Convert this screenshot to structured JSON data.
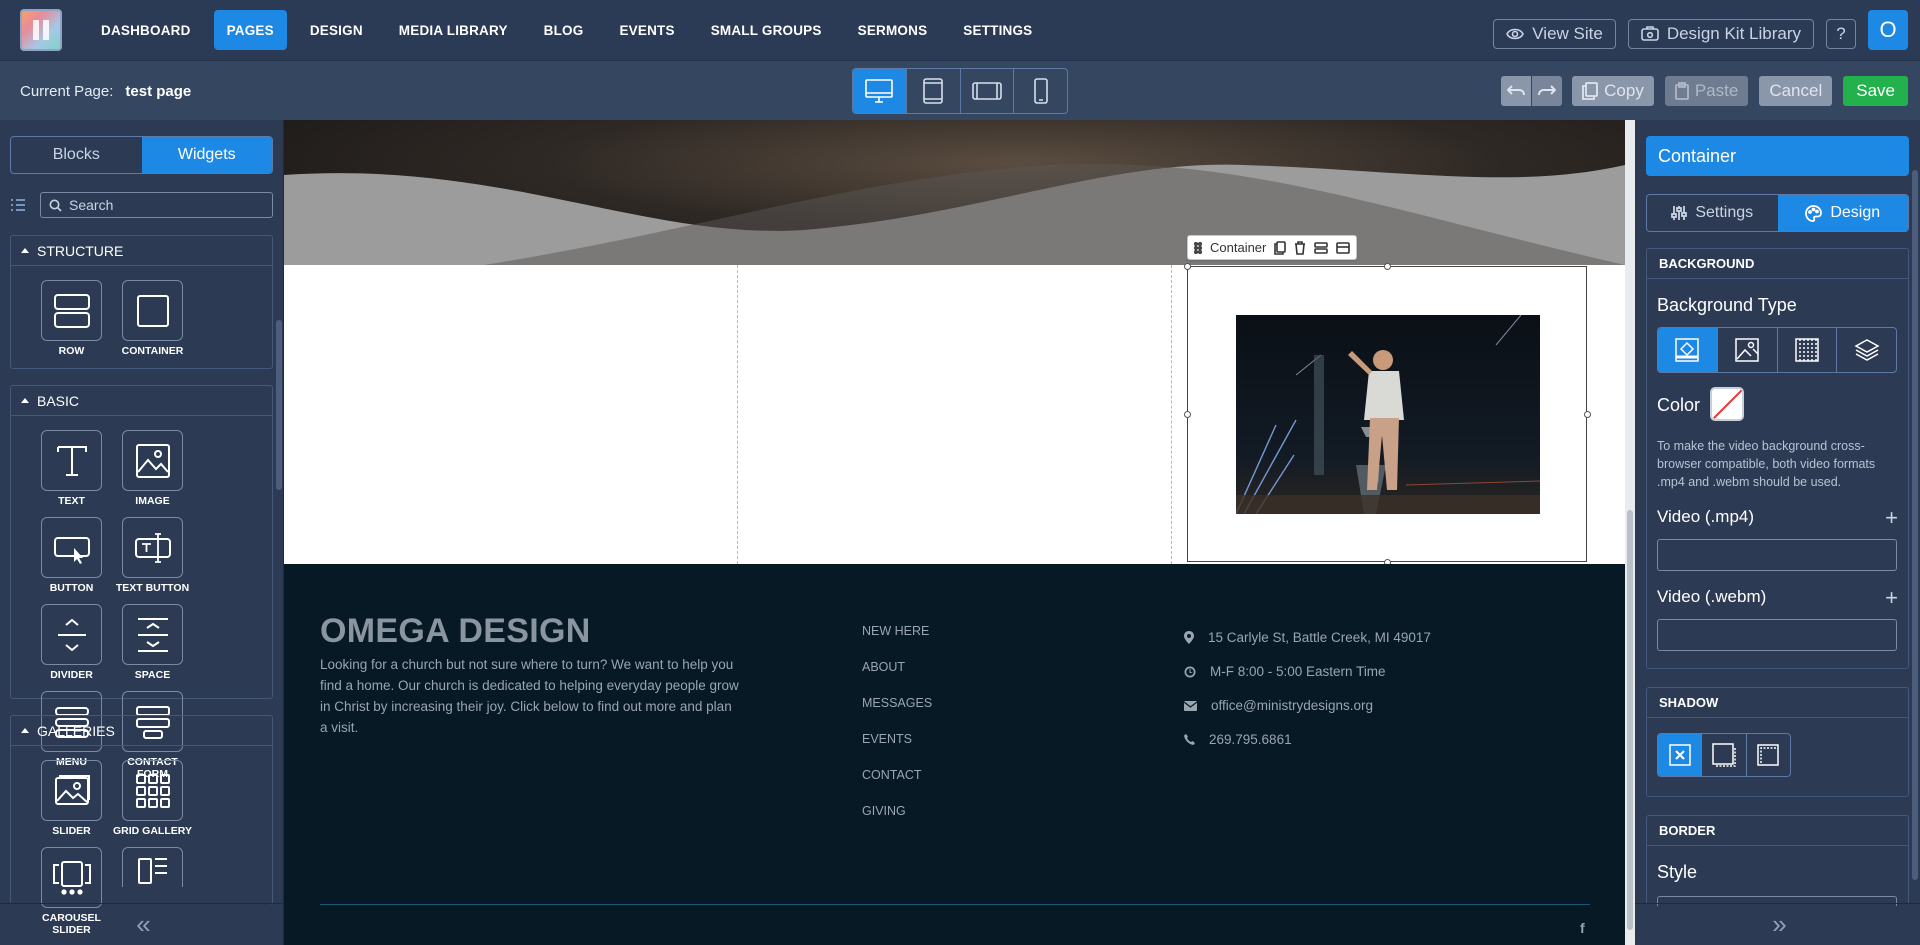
{
  "nav": {
    "items": [
      "DASHBOARD",
      "PAGES",
      "DESIGN",
      "MEDIA LIBRARY",
      "BLOG",
      "EVENTS",
      "SMALL GROUPS",
      "SERMONS",
      "SETTINGS"
    ],
    "active": "PAGES",
    "view_site": "View Site",
    "design_kit": "Design Kit Library",
    "help": "?",
    "avatar": "O"
  },
  "subbar": {
    "current_page_label": "Current Page:",
    "current_page": "test page",
    "copy": "Copy",
    "paste": "Paste",
    "cancel": "Cancel",
    "save": "Save"
  },
  "left": {
    "tabs": [
      "Blocks",
      "Widgets"
    ],
    "active_tab": "Widgets",
    "search_placeholder": "Search",
    "sections": [
      {
        "title": "STRUCTURE",
        "items": [
          {
            "label": "ROW",
            "icon": "row-icon"
          },
          {
            "label": "CONTAINER",
            "icon": "container-icon"
          }
        ]
      },
      {
        "title": "BASIC",
        "items": [
          {
            "label": "TEXT",
            "icon": "text-icon"
          },
          {
            "label": "IMAGE",
            "icon": "image-icon"
          },
          {
            "label": "BUTTON",
            "icon": "button-icon"
          },
          {
            "label": "TEXT BUTTON",
            "icon": "text-button-icon"
          },
          {
            "label": "DIVIDER",
            "icon": "divider-icon"
          },
          {
            "label": "SPACE",
            "icon": "space-icon"
          },
          {
            "label": "MENU",
            "icon": "menu-icon"
          },
          {
            "label": "CONTACT FORM",
            "icon": "contact-form-icon"
          }
        ]
      },
      {
        "title": "GALLERIES",
        "items": [
          {
            "label": "SLIDER",
            "icon": "slider-icon"
          },
          {
            "label": "GRID GALLERY",
            "icon": "grid-gallery-icon"
          },
          {
            "label": "CAROUSEL SLIDER",
            "icon": "carousel-slider-icon"
          }
        ]
      }
    ],
    "collapse": "«"
  },
  "canvas": {
    "container_toolbar_label": "Container",
    "footer": {
      "title": "OMEGA DESIGN",
      "text": "Looking for a church but not sure where to turn? We want to help you find a home. Our church is dedicated to helping everyday people grow in Christ by increasing their joy.  Click below to find out more and plan a visit.",
      "nav": [
        "NEW HERE",
        "ABOUT",
        "MESSAGES",
        "EVENTS",
        "CONTACT",
        "GIVING"
      ],
      "address": "15 Carlyle St, Battle Creek, MI 49017",
      "hours": "M-F 8:00 - 5:00 Eastern Time",
      "email": "office@ministrydesigns.org",
      "phone": "269.795.6861",
      "social": "f"
    }
  },
  "right": {
    "title": "Container",
    "tabs": [
      "Settings",
      "Design"
    ],
    "active_tab": "Design",
    "background": {
      "heading": "BACKGROUND",
      "type_label": "Background Type",
      "color_label": "Color",
      "note": "To make the video background cross-browser compatible, both video formats .mp4 and .webm should be used.",
      "mp4_label": "Video (.mp4)",
      "webm_label": "Video (.webm)"
    },
    "shadow": {
      "heading": "SHADOW"
    },
    "border": {
      "heading": "BORDER",
      "style_label": "Style"
    },
    "expand": "»"
  },
  "colors": {
    "accent": "#1e88e5",
    "save": "#22b14c",
    "panel": "#2c3b53",
    "footer": "#061925"
  }
}
